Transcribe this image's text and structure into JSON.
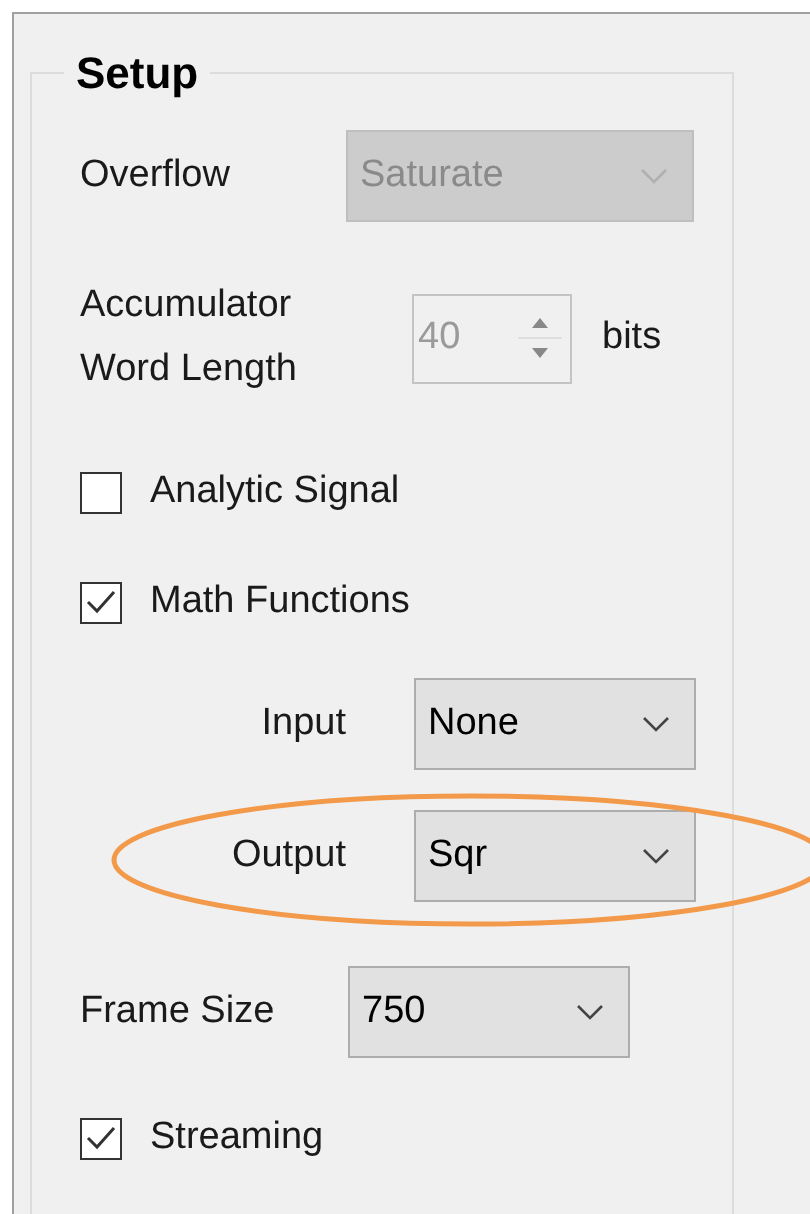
{
  "group": {
    "title": "Setup"
  },
  "overflow": {
    "label": "Overflow",
    "value": "Saturate",
    "disabled": true
  },
  "accumulator": {
    "label_lines": [
      "Accumulator",
      "Word Length"
    ],
    "value": "40",
    "disabled": true,
    "unit": "bits"
  },
  "checkboxes_top": [
    {
      "label": "Analytic Signal",
      "checked": false
    },
    {
      "label": "Math Functions",
      "checked": true
    }
  ],
  "math_rows": [
    {
      "label": "Input",
      "value": "None",
      "highlighted": false
    },
    {
      "label": "Output",
      "value": "Sqr",
      "highlighted": true
    }
  ],
  "frame_size": {
    "label": "Frame Size",
    "value": "750"
  },
  "checkboxes_bottom": [
    {
      "label": "Streaming",
      "checked": true
    }
  ]
}
